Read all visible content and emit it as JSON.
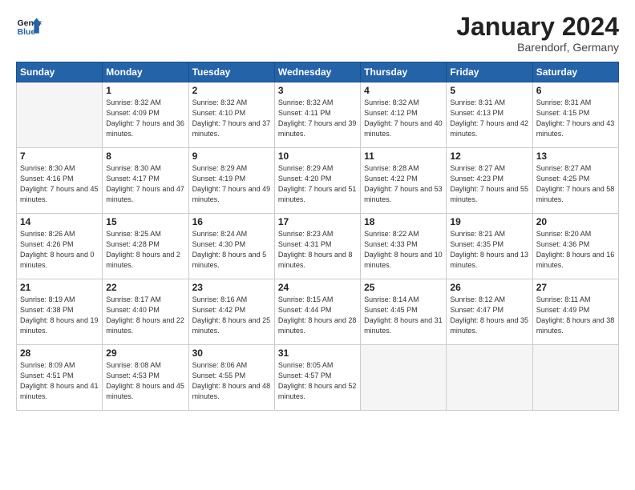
{
  "header": {
    "logo_line1": "General",
    "logo_line2": "Blue",
    "month": "January 2024",
    "location": "Barendorf, Germany"
  },
  "weekdays": [
    "Sunday",
    "Monday",
    "Tuesday",
    "Wednesday",
    "Thursday",
    "Friday",
    "Saturday"
  ],
  "weeks": [
    [
      {
        "day": "",
        "sunrise": "",
        "sunset": "",
        "daylight": "",
        "empty": true
      },
      {
        "day": "1",
        "sunrise": "8:32 AM",
        "sunset": "4:09 PM",
        "daylight": "7 hours and 36 minutes."
      },
      {
        "day": "2",
        "sunrise": "8:32 AM",
        "sunset": "4:10 PM",
        "daylight": "7 hours and 37 minutes."
      },
      {
        "day": "3",
        "sunrise": "8:32 AM",
        "sunset": "4:11 PM",
        "daylight": "7 hours and 39 minutes."
      },
      {
        "day": "4",
        "sunrise": "8:32 AM",
        "sunset": "4:12 PM",
        "daylight": "7 hours and 40 minutes."
      },
      {
        "day": "5",
        "sunrise": "8:31 AM",
        "sunset": "4:13 PM",
        "daylight": "7 hours and 42 minutes."
      },
      {
        "day": "6",
        "sunrise": "8:31 AM",
        "sunset": "4:15 PM",
        "daylight": "7 hours and 43 minutes."
      }
    ],
    [
      {
        "day": "7",
        "sunrise": "8:30 AM",
        "sunset": "4:16 PM",
        "daylight": "7 hours and 45 minutes."
      },
      {
        "day": "8",
        "sunrise": "8:30 AM",
        "sunset": "4:17 PM",
        "daylight": "7 hours and 47 minutes."
      },
      {
        "day": "9",
        "sunrise": "8:29 AM",
        "sunset": "4:19 PM",
        "daylight": "7 hours and 49 minutes."
      },
      {
        "day": "10",
        "sunrise": "8:29 AM",
        "sunset": "4:20 PM",
        "daylight": "7 hours and 51 minutes."
      },
      {
        "day": "11",
        "sunrise": "8:28 AM",
        "sunset": "4:22 PM",
        "daylight": "7 hours and 53 minutes."
      },
      {
        "day": "12",
        "sunrise": "8:27 AM",
        "sunset": "4:23 PM",
        "daylight": "7 hours and 55 minutes."
      },
      {
        "day": "13",
        "sunrise": "8:27 AM",
        "sunset": "4:25 PM",
        "daylight": "7 hours and 58 minutes."
      }
    ],
    [
      {
        "day": "14",
        "sunrise": "8:26 AM",
        "sunset": "4:26 PM",
        "daylight": "8 hours and 0 minutes."
      },
      {
        "day": "15",
        "sunrise": "8:25 AM",
        "sunset": "4:28 PM",
        "daylight": "8 hours and 2 minutes."
      },
      {
        "day": "16",
        "sunrise": "8:24 AM",
        "sunset": "4:30 PM",
        "daylight": "8 hours and 5 minutes."
      },
      {
        "day": "17",
        "sunrise": "8:23 AM",
        "sunset": "4:31 PM",
        "daylight": "8 hours and 8 minutes."
      },
      {
        "day": "18",
        "sunrise": "8:22 AM",
        "sunset": "4:33 PM",
        "daylight": "8 hours and 10 minutes."
      },
      {
        "day": "19",
        "sunrise": "8:21 AM",
        "sunset": "4:35 PM",
        "daylight": "8 hours and 13 minutes."
      },
      {
        "day": "20",
        "sunrise": "8:20 AM",
        "sunset": "4:36 PM",
        "daylight": "8 hours and 16 minutes."
      }
    ],
    [
      {
        "day": "21",
        "sunrise": "8:19 AM",
        "sunset": "4:38 PM",
        "daylight": "8 hours and 19 minutes."
      },
      {
        "day": "22",
        "sunrise": "8:17 AM",
        "sunset": "4:40 PM",
        "daylight": "8 hours and 22 minutes."
      },
      {
        "day": "23",
        "sunrise": "8:16 AM",
        "sunset": "4:42 PM",
        "daylight": "8 hours and 25 minutes."
      },
      {
        "day": "24",
        "sunrise": "8:15 AM",
        "sunset": "4:44 PM",
        "daylight": "8 hours and 28 minutes."
      },
      {
        "day": "25",
        "sunrise": "8:14 AM",
        "sunset": "4:45 PM",
        "daylight": "8 hours and 31 minutes."
      },
      {
        "day": "26",
        "sunrise": "8:12 AM",
        "sunset": "4:47 PM",
        "daylight": "8 hours and 35 minutes."
      },
      {
        "day": "27",
        "sunrise": "8:11 AM",
        "sunset": "4:49 PM",
        "daylight": "8 hours and 38 minutes."
      }
    ],
    [
      {
        "day": "28",
        "sunrise": "8:09 AM",
        "sunset": "4:51 PM",
        "daylight": "8 hours and 41 minutes."
      },
      {
        "day": "29",
        "sunrise": "8:08 AM",
        "sunset": "4:53 PM",
        "daylight": "8 hours and 45 minutes."
      },
      {
        "day": "30",
        "sunrise": "8:06 AM",
        "sunset": "4:55 PM",
        "daylight": "8 hours and 48 minutes."
      },
      {
        "day": "31",
        "sunrise": "8:05 AM",
        "sunset": "4:57 PM",
        "daylight": "8 hours and 52 minutes."
      },
      {
        "day": "",
        "empty": true
      },
      {
        "day": "",
        "empty": true
      },
      {
        "day": "",
        "empty": true
      }
    ]
  ]
}
